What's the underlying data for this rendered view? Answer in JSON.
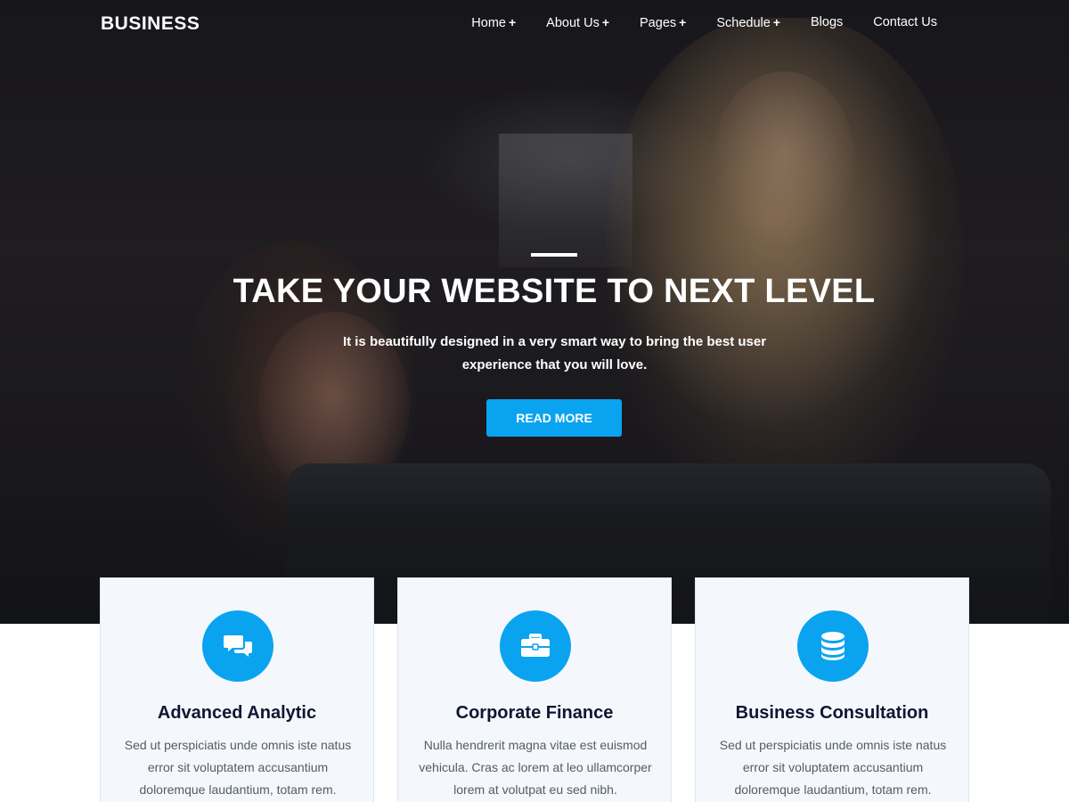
{
  "brand": "BUSINESS",
  "nav": {
    "items": [
      {
        "label": "Home",
        "has_submenu": true
      },
      {
        "label": "About Us",
        "has_submenu": true
      },
      {
        "label": "Pages",
        "has_submenu": true
      },
      {
        "label": "Schedule",
        "has_submenu": true
      },
      {
        "label": "Blogs",
        "has_submenu": false
      },
      {
        "label": "Contact Us",
        "has_submenu": false
      }
    ],
    "submenu_marker": "+"
  },
  "hero": {
    "title": "TAKE YOUR WEBSITE TO NEXT LEVEL",
    "subtitle": "It is beautifully designed in a very smart way to bring the best user experience that you will love.",
    "button_label": "READ MORE"
  },
  "services": [
    {
      "icon": "chat-bubbles-icon",
      "title": "Advanced Analytic",
      "text": "Sed ut perspiciatis unde omnis iste natus error sit voluptatem accusantium doloremque laudantium, totam rem."
    },
    {
      "icon": "briefcase-icon",
      "title": "Corporate Finance",
      "text": "Nulla hendrerit magna vitae est euismod vehicula. Cras ac lorem at leo ullamcorper lorem at volutpat eu sed nibh."
    },
    {
      "icon": "database-icon",
      "title": "Business Consultation",
      "text": "Sed ut perspiciatis unde omnis iste natus error sit voluptatem accusantium doloremque laudantium, totam rem."
    }
  ],
  "colors": {
    "accent": "#0aa3f0",
    "heading": "#0e1730",
    "card_bg": "#f4f8fd"
  }
}
